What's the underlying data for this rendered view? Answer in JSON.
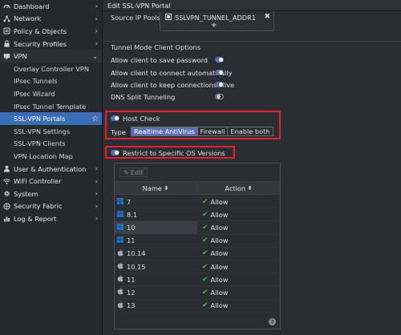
{
  "sidebar": {
    "items": [
      {
        "label": "Dashboard",
        "icon": "dashboard-icon"
      },
      {
        "label": "Network",
        "icon": "network-icon"
      },
      {
        "label": "Policy & Objects",
        "icon": "policy-icon"
      },
      {
        "label": "Security Profiles",
        "icon": "lock-icon"
      },
      {
        "label": "VPN",
        "icon": "monitor-icon"
      },
      {
        "label": "Overlay Controller VPN"
      },
      {
        "label": "IPsec Tunnels"
      },
      {
        "label": "IPsec Wizard"
      },
      {
        "label": "IPsec Tunnel Template"
      },
      {
        "label": "SSL-VPN Portals"
      },
      {
        "label": "SSL-VPN Settings"
      },
      {
        "label": "SSL-VPN Clients"
      },
      {
        "label": "VPN Location Map"
      },
      {
        "label": "User & Authentication",
        "icon": "user-icon"
      },
      {
        "label": "WiFi Controller",
        "icon": "wifi-icon"
      },
      {
        "label": "System",
        "icon": "gear-icon"
      },
      {
        "label": "Security Fabric",
        "icon": "fabric-icon"
      },
      {
        "label": "Log & Report",
        "icon": "chart-icon"
      }
    ]
  },
  "main": {
    "title": "Edit SSL-VPN Portal",
    "source_ip_pools_label": "Source IP Pools",
    "source_ip_pool_value": "SSLVPN_TUNNEL_ADDR1",
    "tunnel_section": "Tunnel Mode Client Options",
    "options": [
      {
        "label": "Allow client to save password",
        "on": true
      },
      {
        "label": "Allow client to connect automatically",
        "on": true
      },
      {
        "label": "Allow client to keep connections alive",
        "on": true
      },
      {
        "label": "DNS Split Tunneling",
        "on": false
      }
    ],
    "host_check_label": "Host Check",
    "type_label": "Type",
    "type_options": [
      "Realtime AntiVirus",
      "Firewall",
      "Enable both"
    ],
    "type_selected": "Realtime AntiVirus",
    "restrict_os_label": "Restrict to Specific OS Versions",
    "edit_label": "Edit",
    "table": {
      "columns": [
        "Name",
        "Action"
      ],
      "rows": [
        {
          "os": "windows",
          "name": "7",
          "action": "Allow"
        },
        {
          "os": "windows",
          "name": "8.1",
          "action": "Allow"
        },
        {
          "os": "windows",
          "name": "10",
          "action": "Allow"
        },
        {
          "os": "windows",
          "name": "11",
          "action": "Allow"
        },
        {
          "os": "apple",
          "name": "10.14",
          "action": "Allow"
        },
        {
          "os": "apple",
          "name": "10.15",
          "action": "Allow"
        },
        {
          "os": "apple",
          "name": "11",
          "action": "Allow"
        },
        {
          "os": "apple",
          "name": "12",
          "action": "Allow"
        },
        {
          "os": "apple",
          "name": "13",
          "action": "Allow"
        }
      ]
    }
  },
  "colors": {
    "accent": "#5a6fb0",
    "active_nav": "#3a6db5",
    "highlight_box": "#e4202a",
    "allow_check": "#46b35a",
    "windows_icon": "#1e6fd9"
  }
}
